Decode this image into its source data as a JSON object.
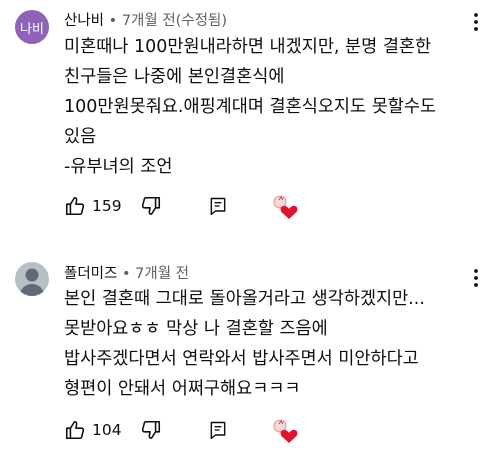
{
  "comments": [
    {
      "avatar_text": "나비",
      "avatar_color": "#8e63b8",
      "author": "산나비",
      "separator": " • ",
      "time": "7개월 전(수정됨)",
      "lines": [
        "미혼때나 100만원내라하면 내겠지만, 분명 결혼한",
        "친구들은 나중에 본인결혼식에",
        "100만원못줘요.애핑계대며 결혼식오지도 못할수도",
        "있음",
        "-유부녀의 조언"
      ],
      "likes": "159",
      "like_icon": "thumbs-up-icon",
      "dislike_icon": "thumbs-down-icon",
      "reply_icon": "reply-icon",
      "heart_color": "#e0152d"
    },
    {
      "avatar_color": "#b9bec3",
      "author": "폴더미즈",
      "separator": " • ",
      "time": "7개월 전",
      "lines": [
        "본인 결혼때 그대로 돌아올거라고 생각하겠지만...",
        "못받아요ㅎㅎ 막상 나 결혼할 즈음에",
        "밥사주겠다면서 연락와서 밥사주면서 미안하다고",
        "형편이 안돼서 어쩌구해요ㅋㅋㅋ"
      ],
      "likes": "104",
      "like_icon": "thumbs-up-icon",
      "dislike_icon": "thumbs-down-icon",
      "reply_icon": "reply-icon",
      "heart_color": "#e0152d"
    }
  ]
}
